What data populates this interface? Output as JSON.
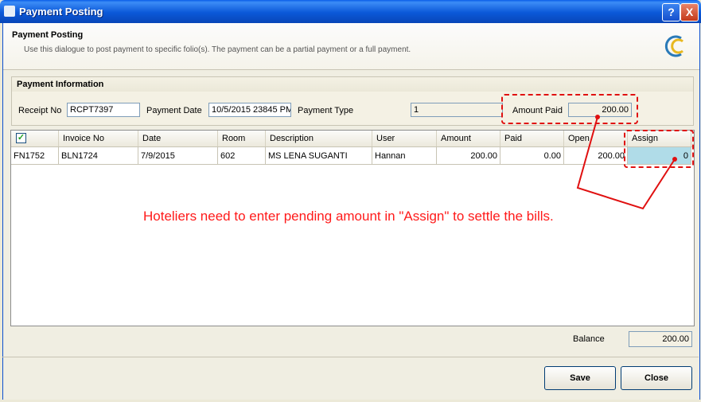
{
  "window": {
    "title": "Payment Posting",
    "help_label": "?",
    "close_label": "X"
  },
  "header": {
    "title": "Payment Posting",
    "subtitle": "Use this dialogue to post payment to specific folio(s). The payment can be a partial payment or a full payment."
  },
  "payment_info": {
    "group_title": "Payment Information",
    "receipt_no_label": "Receipt No",
    "receipt_no": "RCPT7397",
    "payment_date_label": "Payment Date",
    "payment_date": "10/5/2015 23845 PM",
    "payment_type_label": "Payment Type",
    "payment_type": "1",
    "amount_paid_label": "Amount Paid",
    "amount_paid": "200.00"
  },
  "grid": {
    "columns": [
      "Invoice No",
      "Date",
      "Room",
      "Description",
      "User",
      "Amount",
      "Paid",
      "Open",
      "Assign"
    ],
    "rows": [
      {
        "folio": "FN1752",
        "invoice_no": "BLN1724",
        "date": "7/9/2015",
        "room": "602",
        "description": "MS LENA SUGANTI",
        "user": "Hannan",
        "amount": "200.00",
        "paid": "0.00",
        "open": "200.00",
        "assign": "0"
      }
    ]
  },
  "annotation": "Hoteliers need to enter pending amount in \"Assign\" to settle the bills.",
  "footer": {
    "balance_label": "Balance",
    "balance": "200.00",
    "save_label": "Save",
    "close_label": "Close"
  },
  "colors": {
    "title_bar": "#0b58d8",
    "annotation": "#ff1a1a",
    "assign_cell": "#b0dce8"
  }
}
